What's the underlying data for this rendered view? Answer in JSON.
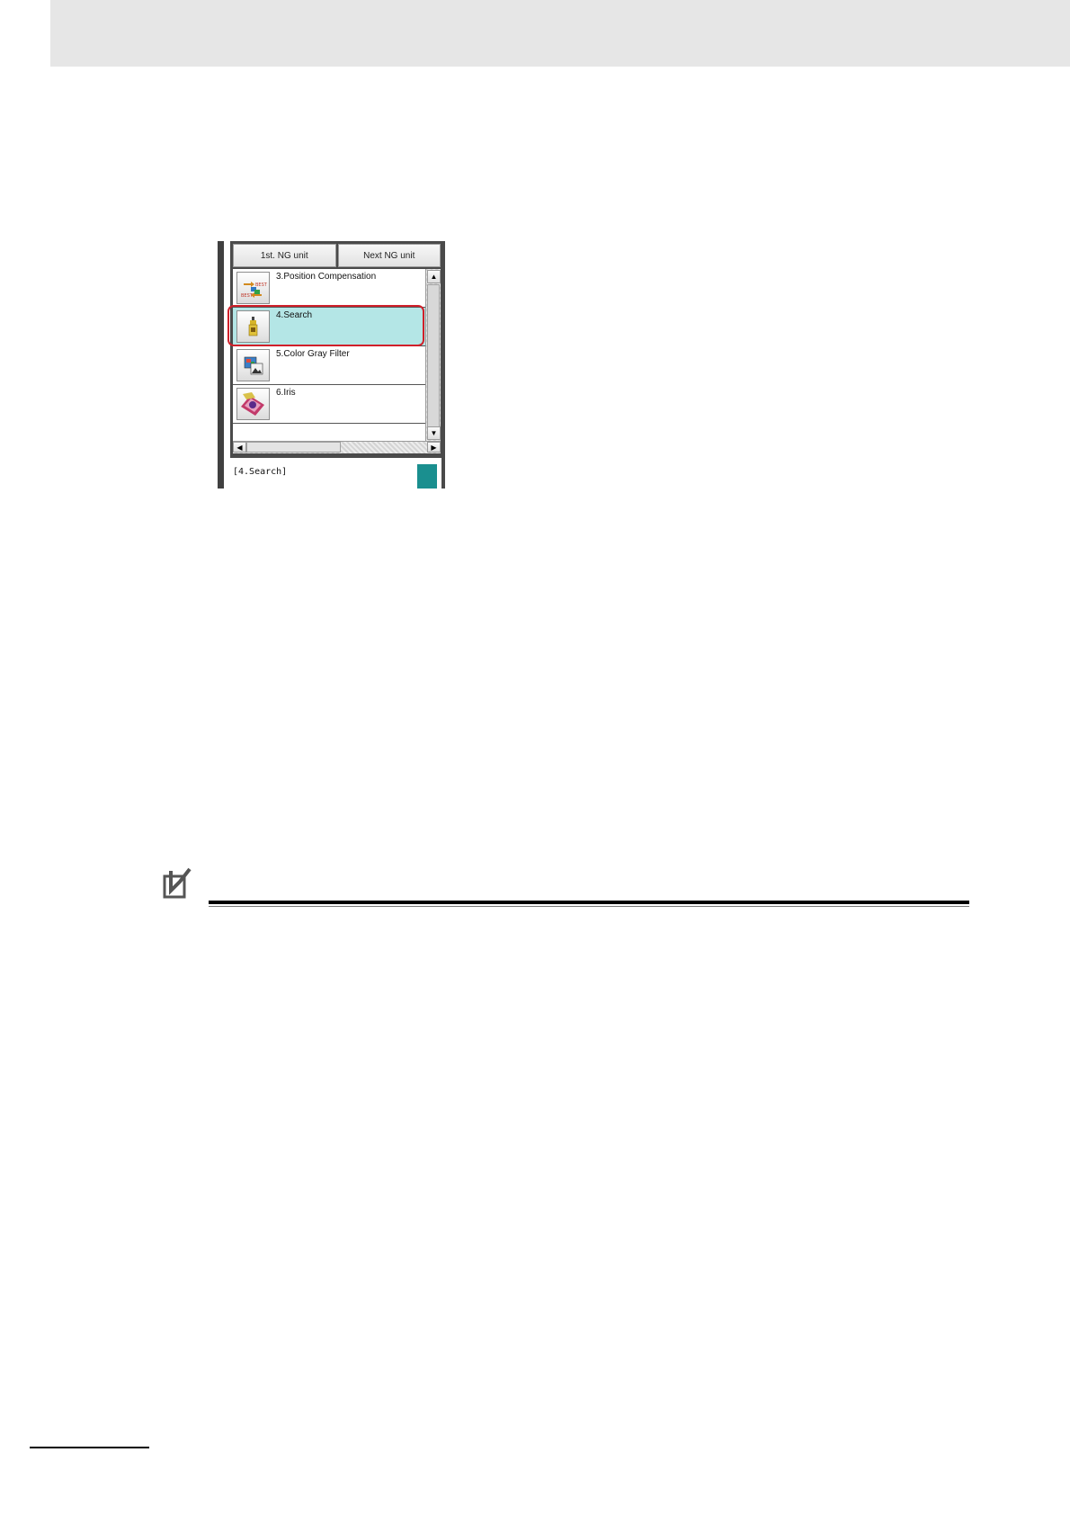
{
  "panel": {
    "buttons": [
      "1st. NG unit",
      "Next NG unit"
    ],
    "items": [
      {
        "label": "3.Position Compensation",
        "icon": "position-compensation-icon"
      },
      {
        "label": "4.Search",
        "icon": "search-unit-icon",
        "selected": true
      },
      {
        "label": "5.Color Gray Filter",
        "icon": "color-gray-filter-icon"
      },
      {
        "label": "6.Iris",
        "icon": "iris-icon"
      }
    ],
    "status": "[4.Search]",
    "colors": {
      "selected_row": "#b4e6e6",
      "highlight_outline": "#d0202a",
      "status_indicator": "#1a8f8f"
    }
  },
  "note": {
    "icon": "precautions-icon"
  }
}
